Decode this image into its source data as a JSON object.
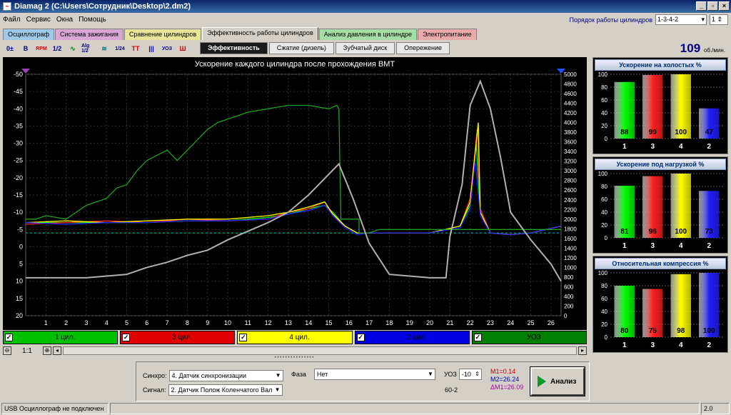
{
  "window": {
    "title": "Diamag 2 (C:\\Users\\Сотрудник\\Desktop\\2.dm2)",
    "min": "_",
    "max": "▫",
    "close": "×"
  },
  "menu": [
    "Файл",
    "Сервис",
    "Окна",
    "Помощь"
  ],
  "cyl_order": {
    "label": "Порядок работы цилиндров",
    "value": "1-3-4-2",
    "spin": "1"
  },
  "tabs": [
    {
      "label": "Осциллограф",
      "color": "#9ec9e8"
    },
    {
      "label": "Система зажигания",
      "color": "#d9a6d6"
    },
    {
      "label": "Сравнение цилиндров",
      "color": "#e9e49a"
    },
    {
      "label": "Эффективность работы цилиндров",
      "color": "#d4d0c8"
    },
    {
      "label": "Анализ давления в цилиндре",
      "color": "#a6dca6"
    },
    {
      "label": "Электропитание",
      "color": "#e9aaaa"
    }
  ],
  "toolbar_icons": [
    "0±",
    "B",
    "RPM",
    "1/2",
    "∿",
    "Alg 1/2",
    "≋",
    "1/24",
    "TT",
    "|||",
    "УОЗ",
    "Ш"
  ],
  "subtabs": [
    "Эффективность",
    "Сжатие (дизель)",
    "Зубчатый диск",
    "Опережение"
  ],
  "rpm": {
    "value": "109",
    "unit": "об./мин."
  },
  "chart_data": {
    "type": "line",
    "title": "Ускорение каждого цилиндра после прохождения ВМТ",
    "x_ticks": [
      1,
      2,
      3,
      4,
      5,
      6,
      7,
      8,
      9,
      10,
      11,
      12,
      13,
      14,
      15,
      16,
      17,
      18,
      19,
      20,
      21,
      22,
      23,
      24,
      25,
      26
    ],
    "ylim_left": [
      20,
      -50
    ],
    "y_left_ticks": [
      -50,
      -45,
      -40,
      -35,
      -30,
      -25,
      -20,
      -15,
      -10,
      -5,
      0,
      5,
      10,
      15,
      20
    ],
    "ylim_right": [
      0,
      5000
    ],
    "y_right_ticks": [
      5000,
      4800,
      4600,
      4400,
      4200,
      4000,
      3800,
      3600,
      3400,
      3200,
      3000,
      2800,
      2600,
      2400,
      2200,
      2000,
      1800,
      1600,
      1400,
      1200,
      1000,
      800,
      600,
      400,
      200,
      0
    ],
    "series": [
      {
        "name": "1 цил.",
        "color": "#00ff00",
        "x": [
          0,
          2,
          4,
          6,
          8,
          10,
          12,
          13,
          14,
          14.8,
          15.2,
          15.8,
          16.4,
          17,
          18,
          20,
          21.5,
          22,
          22.3,
          22.5,
          23,
          24,
          25,
          26.5
        ],
        "y": [
          -7,
          -7,
          -7,
          -7,
          -7.5,
          -7.5,
          -8.5,
          -9.5,
          -11,
          -12,
          -10,
          -6,
          -4,
          -4,
          -4,
          -4,
          -6,
          -12,
          -30,
          -10,
          -4,
          -3.5,
          -4,
          -6
        ]
      },
      {
        "name": "3 цил.",
        "color": "#ff2020",
        "x": [
          0,
          2,
          4,
          6,
          8,
          10,
          12,
          13,
          14,
          14.8,
          15.2,
          15.8,
          16.4,
          17,
          18,
          20,
          21.5,
          22,
          22.35,
          22.5,
          23,
          24,
          25,
          26.5
        ],
        "y": [
          -6.5,
          -7,
          -7.5,
          -7,
          -8,
          -7.5,
          -8,
          -10,
          -11,
          -13,
          -9,
          -6,
          -4,
          -4,
          -4,
          -4,
          -6,
          -14,
          -34,
          -11,
          -4,
          -3.5,
          -4,
          -6
        ]
      },
      {
        "name": "4 цил.",
        "color": "#ffff00",
        "x": [
          0,
          2,
          4,
          6,
          8,
          10,
          12,
          13,
          14,
          14.8,
          15.2,
          15.8,
          16.4,
          17,
          18,
          20,
          21.5,
          22,
          22.4,
          22.5,
          23,
          24,
          25,
          26.5
        ],
        "y": [
          -7,
          -7.5,
          -7,
          -7.5,
          -8,
          -8,
          -9,
          -10,
          -11.5,
          -13,
          -9.5,
          -6,
          -4,
          -4,
          -4,
          -4,
          -6,
          -13,
          -36,
          -10,
          -4,
          -3.5,
          -4,
          -6
        ]
      },
      {
        "name": "2 цил.",
        "color": "#2020ff",
        "x": [
          0,
          2,
          4,
          6,
          8,
          10,
          12,
          13,
          14,
          14.8,
          15.2,
          15.8,
          16.4,
          17,
          18,
          20,
          21.5,
          22,
          22.25,
          22.5,
          23,
          24,
          25,
          26.5
        ],
        "y": [
          -7,
          -6.5,
          -7,
          -7,
          -7.5,
          -7.5,
          -8,
          -9.5,
          -10.5,
          -12,
          -9,
          -5.5,
          -3.5,
          -4,
          -4,
          -4,
          -5.5,
          -11,
          -25,
          -9,
          -4,
          -3.5,
          -4,
          -6
        ]
      },
      {
        "name": "УОЗ",
        "color": "#20a020",
        "x": [
          0,
          0.5,
          1,
          2,
          2.5,
          3,
          4,
          4.5,
          5,
          5.5,
          6,
          7,
          7.5,
          8,
          9,
          9.5,
          10,
          11,
          12,
          13,
          14,
          15,
          15.4,
          15.5,
          15.6,
          16.5,
          16.5,
          17,
          17.5,
          20,
          21,
          22,
          22.5,
          23,
          23.5,
          26.5
        ],
        "y": [
          -8,
          -8,
          -9,
          -8,
          -10,
          -12,
          -14,
          -17,
          -18,
          -22,
          -25,
          -28,
          -25,
          -28,
          -34,
          -36,
          -37,
          -39,
          -40,
          -41,
          -41,
          -40,
          -41,
          -40,
          -8,
          -8,
          -4,
          -4,
          -5,
          -5,
          -5,
          -5,
          -5,
          -5,
          -5,
          -5
        ]
      },
      {
        "name": "",
        "color": "#b0b0b0",
        "x": [
          0,
          1,
          2,
          3,
          4,
          5,
          6,
          7,
          8,
          9,
          10,
          11,
          12,
          13,
          14,
          15,
          15.5,
          16.2,
          17,
          18,
          19,
          20,
          20.8,
          21,
          21.6,
          22,
          22.5,
          23,
          23.5,
          24,
          25,
          26,
          26.5
        ],
        "y": [
          9,
          9,
          9,
          9,
          8.5,
          8,
          6,
          4.5,
          2.5,
          1,
          -2,
          -4.5,
          -7,
          -10,
          -15,
          -21,
          -24,
          -14,
          -1,
          8,
          8.5,
          9,
          9,
          -3,
          -18,
          -41,
          -48,
          -40,
          -26,
          -10,
          -2,
          5,
          10
        ]
      }
    ]
  },
  "legend": [
    {
      "label": "1 цил.",
      "bg": "#00c000",
      "fg": "#000"
    },
    {
      "label": "3 цил.",
      "bg": "#e00000",
      "fg": "#000"
    },
    {
      "label": "4 цил.",
      "bg": "#ffff00",
      "fg": "#000"
    },
    {
      "label": "2 цил.",
      "bg": "#0000e0",
      "fg": "#000"
    },
    {
      "label": "УОЗ",
      "bg": "#008000",
      "fg": "#000"
    }
  ],
  "legend_check": "✓",
  "zoom": "1:1",
  "bar_panels": [
    {
      "title": "Ускорение на холостых %",
      "ticks": [
        100,
        80,
        60,
        40,
        20,
        0
      ],
      "categories": [
        "1",
        "3",
        "4",
        "2"
      ],
      "values": [
        88,
        99,
        100,
        47
      ],
      "colors": [
        "#00ff00",
        "#ff2020",
        "#ffff00",
        "#2020ff"
      ]
    },
    {
      "title": "Ускорение под нагрузкой %",
      "ticks": [
        100,
        80,
        60,
        40,
        20,
        0
      ],
      "categories": [
        "1",
        "3",
        "4",
        "2"
      ],
      "values": [
        81,
        96,
        100,
        73
      ],
      "colors": [
        "#00ff00",
        "#ff2020",
        "#ffff00",
        "#2020ff"
      ]
    },
    {
      "title": "Относительная компрессия %",
      "ticks": [
        100,
        80,
        60,
        40,
        20,
        0
      ],
      "categories": [
        "1",
        "3",
        "4",
        "2"
      ],
      "values": [
        80,
        75,
        98,
        100
      ],
      "colors": [
        "#00ff00",
        "#ff2020",
        "#ffff00",
        "#2020ff"
      ]
    }
  ],
  "controls": {
    "sync_label": "Синхро:",
    "sync_value": "4. Датчик синхронизации",
    "signal_label": "Сигнал:",
    "signal_value": "2. Датчик Полож Коленчатого Вал",
    "phase_label": "Фаза",
    "phase_value": "Нет",
    "uoz_label": "УОЗ",
    "uoz_value": "-10",
    "gear": "60-2",
    "m1": "M1=0.14",
    "m2": "M2=26.24",
    "dm": "ΔM1=26.09",
    "analyze": "Анализ"
  },
  "status": {
    "left": "USB Осциллограф не подключен",
    "right": "2.0"
  }
}
